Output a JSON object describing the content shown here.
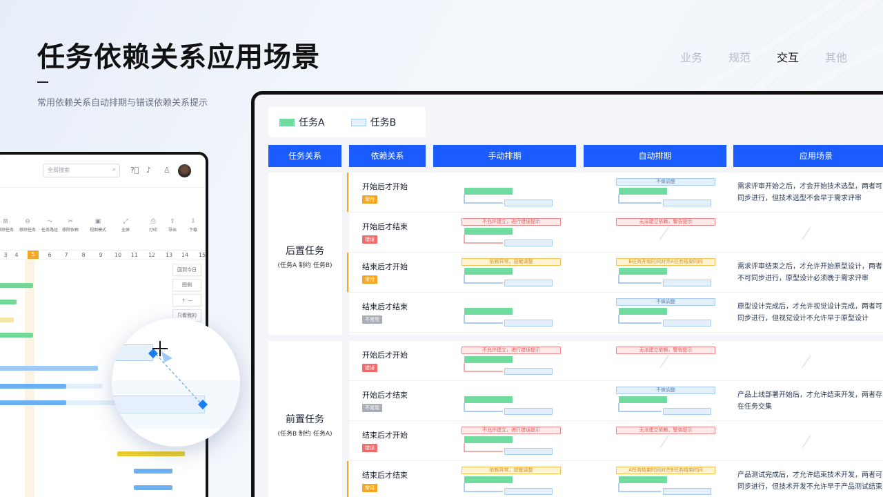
{
  "page": {
    "title": "任务依赖关系应用场景",
    "subtitle": "常用依赖关系自动排期与错误依赖关系提示",
    "nav": [
      "业务",
      "规范",
      "交互",
      "其他"
    ],
    "nav_active": "交互"
  },
  "app": {
    "search_placeholder": "全局搜索",
    "toolbar": [
      "移除任务",
      "任务路径",
      "移除依赖",
      "视图模式",
      "全屏",
      "打印",
      "导出",
      "下载"
    ],
    "day_numbers": [
      "3",
      "4",
      "5",
      "6",
      "7",
      "8",
      "9",
      "10",
      "11",
      "12",
      "13",
      "14",
      "15"
    ],
    "highlight_day": "5",
    "side_buttons": [
      "回到今日",
      "图例",
      "＋  —",
      "只看我的"
    ]
  },
  "legend": {
    "task_a": "任务A",
    "task_b": "任务B",
    "color_a": "#72dba0",
    "color_b": "#e3f0fc"
  },
  "headers": [
    "任务关系",
    "依赖关系",
    "手动排期",
    "自动排期",
    "应用场景"
  ],
  "groups": [
    {
      "name": "后置任务",
      "sub": "(任务A 制约 任务B)",
      "rows": [
        {
          "name": "开始后才开始",
          "tag": "常用",
          "tag_type": "common",
          "manual_label": "",
          "auto_label": "不做调整",
          "scenario": "需求评审开始之后，才会开始技术选型，两者可同步进行，但技术选型不会早于需求评审"
        },
        {
          "name": "开始后才结束",
          "tag": "错误",
          "tag_type": "error",
          "manual_label": "不允许建立，进行错误提示",
          "auto_label": "无法建立依赖，警告提示",
          "scenario": ""
        },
        {
          "name": "结束后才开始",
          "tag": "常用",
          "tag_type": "common",
          "manual_label": "依赖异常，提醒调整",
          "auto_label": "B任务开始时间对齐A任务结束时间",
          "scenario": "需求评审结束之后，才允许开始原型设计，两者不可同步进行，原型设计必须晚于需求评审"
        },
        {
          "name": "结束后才结束",
          "tag": "不常用",
          "tag_type": "rare",
          "manual_label": "",
          "auto_label": "不做调整",
          "scenario": "原型设计完成后，才允许视觉设计完成，两者可同步进行，但视觉设计不允许早于原型设计"
        }
      ]
    },
    {
      "name": "前置任务",
      "sub": "(任务B 制约 任务A)",
      "rows": [
        {
          "name": "开始后才开始",
          "tag": "错误",
          "tag_type": "error",
          "manual_label": "不允许建立，进行错误提示",
          "auto_label": "无法建立依赖，警告提示",
          "scenario": ""
        },
        {
          "name": "开始后才结束",
          "tag": "不常用",
          "tag_type": "rare",
          "manual_label": "",
          "auto_label": "不做调整",
          "scenario": "产品上线部署开始后，才允许结束开发，两者存在任务交集"
        },
        {
          "name": "结束后才开始",
          "tag": "错误",
          "tag_type": "error",
          "manual_label": "不允许建立，进行错误提示",
          "auto_label": "无法建立依赖，警告提示",
          "scenario": ""
        },
        {
          "name": "结束后才结束",
          "tag": "常用",
          "tag_type": "common",
          "manual_label": "依赖异常，提醒调整",
          "auto_label": "A任务结束时间对齐B任务结束时间",
          "scenario": "产品测试完成后，才允许结束技术开发，两者可同步进行，但技术开发不允许早于产品测试结束"
        }
      ]
    }
  ],
  "colors": {
    "accent": "#1a5cff",
    "common": "#f5a623",
    "error": "#f06b6b",
    "rare": "#a9adb5"
  }
}
